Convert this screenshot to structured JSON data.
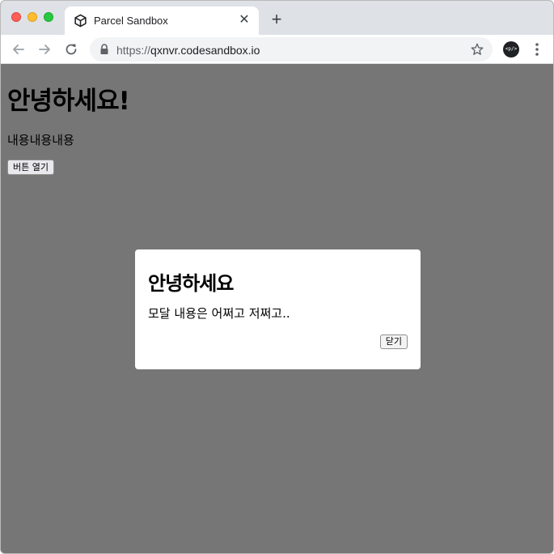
{
  "browser": {
    "tab_title": "Parcel Sandbox",
    "tab_close": "✕",
    "new_tab": "+",
    "url_scheme": "https://",
    "url_host": "qxnvr.codesandbox.io",
    "extension_label": "<p/>",
    "icons": [
      "codesandbox-icon",
      "back-icon",
      "forward-icon",
      "reload-icon",
      "lock-icon",
      "star-icon",
      "menu-icon"
    ]
  },
  "page": {
    "heading": "안녕하세요!",
    "content": "내용내용내용",
    "open_button": "버튼 열기"
  },
  "modal": {
    "title": "안녕하세요",
    "message": "모달 내용은 어쩌고 저쩌고..",
    "close_button": "닫기"
  },
  "colors": {
    "overlay": "#767676",
    "tab_strip": "#dee1e6",
    "modal_bg": "#ffffff"
  }
}
